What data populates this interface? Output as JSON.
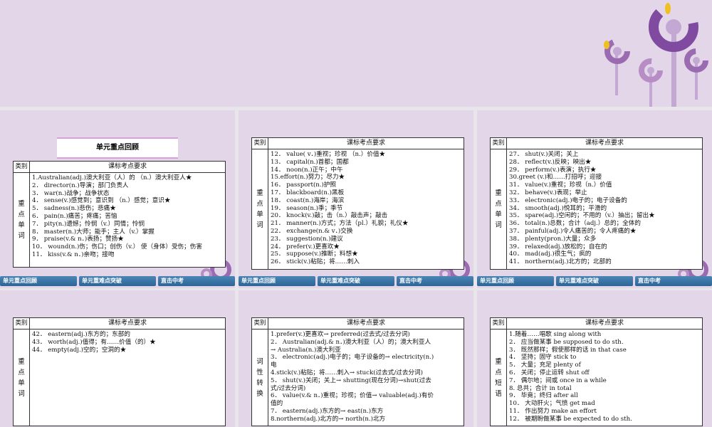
{
  "nav": [
    "单元重点回顾",
    "单元重难点突破",
    "直击中考"
  ],
  "header": {
    "cat": "类别",
    "req": "课标考点要求"
  },
  "slides": [
    {
      "banner": "单元重点回顾",
      "cat": [
        "重",
        "点",
        "单",
        "词"
      ],
      "lines": [
        "1.Australian(adj.)澳大利亚（人）的 （n.）澳大利亚人★",
        "2． director(n.)导演；部门负责人",
        "3． war(n.)战争；战争状态",
        "4． sense(v.)感觉到；意识到 （n.）感觉；意识★",
        "5． sadness(n.)悲伤；悲痛★",
        "6． pain(n.)痛苦；疼痛；苦恼",
        "7． pity(n.)遗憾；怜悯（v.）同情；怜悯",
        "8． master(n.)大师；能手；主人（v.）掌握",
        "9． praise(v.& n．)表扬；赞扬★",
        "10． wound(n.)伤；伤口；创伤（v.） 使（身体）受伤；伤害",
        "11． kiss(v.& n．)亲吻；接吻"
      ]
    },
    {
      "cat": [
        "重",
        "点",
        "单",
        "词"
      ],
      "lines": [
        "12． value( v．)重视；珍视 （n.）价值★",
        "13． capital(n.)首都；国都",
        "14． noon(n.)正午；中午",
        "15.effort(n.)努力；尽力★",
        "16． passport(n.)护照",
        "17． blackboard(n.)黑板",
        "18． coast(n.)海岸；海滨",
        "19． season(n.)季；季节",
        "20． knock(v.)敲；击（n.）敲击声；敲击",
        "21． manner(n.)方式；方法（pl.）礼貌；礼仪★",
        "22． exchange(n.& v．)交换",
        "23． suggestion(n.)建议",
        "24． prefer(v.)更喜欢★",
        "25． suppose(v.)推断；料想★",
        "26． stick(v.)粘贴；将……刺入"
      ]
    },
    {
      "cat": [
        "重",
        "点",
        "单",
        "词"
      ],
      "lines": [
        "27． shut(v.)关闭；关上",
        "28． reflect(v.)反映；映出★",
        "29． perform(v.)表演；执行★",
        "30.greet (v.)和……打招呼；迎接",
        "31． value(v.)重视；珍视（n.）价值",
        "32． behave(v.)表现；举止",
        "33． electronic(adj.)电子的；电子设备的",
        "34． smooth(adj.)悦耳的；平滑的",
        "35． spare(adj.)空闲的；不用的（v.）抽出；留出★",
        "36． total(n.)总数；合计（adj.）总的；全体的",
        "37． painful(adj.)令人痛苦的；令人疼痛的★",
        "38． plenty(pron.)大量；众多",
        "39． relaxed(adj.)放松的；自在的",
        "40． mad(adj.)很生气；疯的",
        "41． northern(adj.)北方的；北部的"
      ]
    },
    {
      "cat": [
        "重",
        "点",
        "单",
        "词"
      ],
      "lines": [
        "42． eastern(adj.)东方的；东部的",
        "43． worth(adj.)值得；有……价值（的）★",
        "44． empty(adj.)空的；空洞的★"
      ]
    },
    {
      "cat": [
        "词",
        "性",
        "转",
        "换"
      ],
      "lines": [
        "1.prefer(v.)更喜欢→ preferred(过去式/过去分词)",
        "2． Australian(adj.& n．)澳大利亚（人）的；澳大利亚人",
        "→ Australia(n.)澳大利亚",
        "3． electronic(adj.)电子的；电子设备的→ electricity(n.)",
        "电",
        "4.stick(v.)粘贴；将……刺入→ stuck(过去式/过去分词)",
        "5． shut(v.)关闭；关上→ shutting(现在分词)→shut(过去",
        "式/过去分词)",
        "6． value(v.& n．)重视；珍视；价值→ valuable(adj.)有价",
        "值的",
        "7． eastern(adj.)东方的→ east(n.)东方",
        "8.northern(adj.)北方的→ north(n.)北方"
      ]
    },
    {
      "cat": [
        "重",
        "点",
        "短",
        "语"
      ],
      "lines": [
        "1.随着……唱歌 sing along with",
        "2． 应当做某事 be supposed to do sth.",
        "3． 既然那样；假使那样的话 in that case",
        "4． 坚持；固守 stick to",
        "5． 大量；充足 plenty of",
        "6． 关闭；停止运转 shut off",
        "7． 偶尔地；间或 once in a while",
        "8. 总共；合计 in total",
        "9． 毕竟；终归 after all",
        "10． 大动肝火；气愤 get mad",
        "11． 作出努力 make an effort",
        "12． 被期盼做某事 be expected to do sth."
      ]
    }
  ]
}
